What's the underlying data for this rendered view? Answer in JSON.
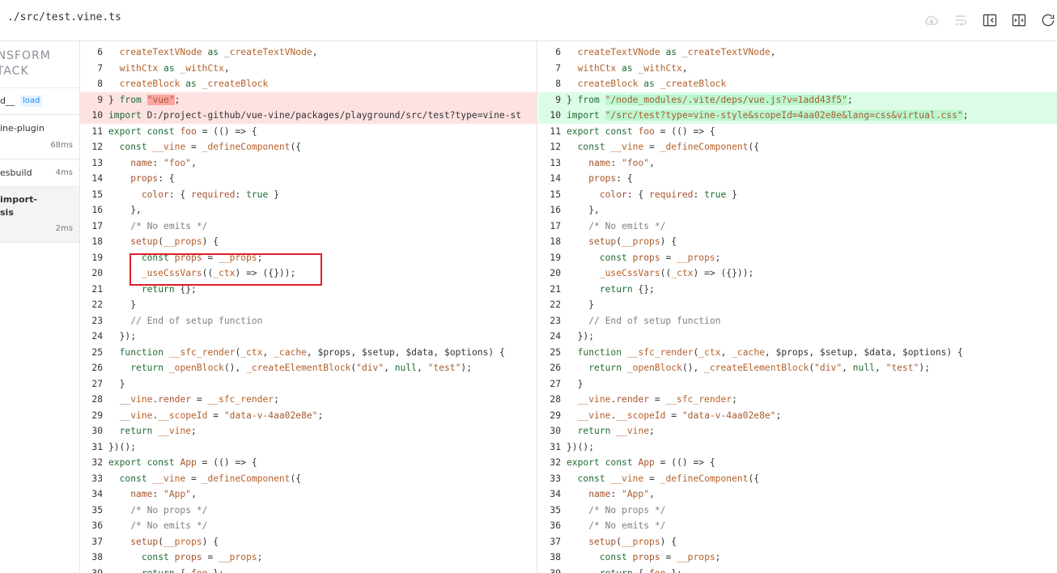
{
  "header": {
    "file_path": "./src/test.vine.ts",
    "icons": [
      "cloud-icon",
      "wrap-lines-icon",
      "collapse-left-icon",
      "diff-split-icon",
      "refresh-icon"
    ]
  },
  "sidebar": {
    "title": "ANSFORM STACK",
    "rows": [
      {
        "name": "d__",
        "badge": "load",
        "time": ""
      },
      {
        "name": "ine-plugin",
        "time": "68ms"
      },
      {
        "name": "esbuild",
        "time": "4ms"
      },
      {
        "name": "import-\nsis",
        "time": "2ms"
      }
    ]
  },
  "colors": {
    "removed_bg": "#fee2e2",
    "added_bg": "#dcfce7",
    "highlight_box": "#e11d2a"
  },
  "left_lines": [
    {
      "n": "6",
      "t": "  createTextVNode as _createTextVNode,"
    },
    {
      "n": "7",
      "t": "  withCtx as _withCtx,"
    },
    {
      "n": "8",
      "t": "  createBlock as _createBlock"
    },
    {
      "n": "9",
      "t": "} from \"vue\";",
      "type": "del"
    },
    {
      "n": "10",
      "t": "import \"D:/project-github/vue-vine/packages/playground/src/test?type=vine-st",
      "type": "del"
    },
    {
      "n": "11",
      "t": "export const foo = (() => {"
    },
    {
      "n": "12",
      "t": "  const __vine = _defineComponent({"
    },
    {
      "n": "13",
      "t": "    name: \"foo\","
    },
    {
      "n": "14",
      "t": "    props: {"
    },
    {
      "n": "15",
      "t": "      color: { required: true }"
    },
    {
      "n": "16",
      "t": "    },"
    },
    {
      "n": "17",
      "t": "    /* No emits */"
    },
    {
      "n": "18",
      "t": "    setup(__props) {"
    },
    {
      "n": "19",
      "t": "      const props = __props;"
    },
    {
      "n": "20",
      "t": "      _useCssVars((_ctx) => ({}));"
    },
    {
      "n": "21",
      "t": "      return {};"
    },
    {
      "n": "22",
      "t": "    }"
    },
    {
      "n": "23",
      "t": "    // End of setup function"
    },
    {
      "n": "24",
      "t": "  });"
    },
    {
      "n": "25",
      "t": "  function __sfc_render(_ctx, _cache, $props, $setup, $data, $options) {"
    },
    {
      "n": "26",
      "t": "    return _openBlock(), _createElementBlock(\"div\", null, \"test\");"
    },
    {
      "n": "27",
      "t": "  }"
    },
    {
      "n": "28",
      "t": "  __vine.render = __sfc_render;"
    },
    {
      "n": "29",
      "t": "  __vine.__scopeId = \"data-v-4aa02e8e\";"
    },
    {
      "n": "30",
      "t": "  return __vine;"
    },
    {
      "n": "31",
      "t": "})();"
    },
    {
      "n": "32",
      "t": "export const App = (() => {"
    },
    {
      "n": "33",
      "t": "  const __vine = _defineComponent({"
    },
    {
      "n": "34",
      "t": "    name: \"App\","
    },
    {
      "n": "35",
      "t": "    /* No props */"
    },
    {
      "n": "36",
      "t": "    /* No emits */"
    },
    {
      "n": "37",
      "t": "    setup(__props) {"
    },
    {
      "n": "38",
      "t": "      const props = __props;"
    },
    {
      "n": "39",
      "t": "      return { foo };"
    }
  ],
  "right_lines": [
    {
      "n": "6",
      "t": "  createTextVNode as _createTextVNode,"
    },
    {
      "n": "7",
      "t": "  withCtx as _withCtx,"
    },
    {
      "n": "8",
      "t": "  createBlock as _createBlock"
    },
    {
      "n": "9",
      "t": "} from \"/node_modules/.vite/deps/vue.js?v=1add43f5\";",
      "type": "add"
    },
    {
      "n": "10",
      "t": "import \"/src/test?type=vine-style&scopeId=4aa02e8e&lang=css&virtual.css\";",
      "type": "add"
    },
    {
      "n": "11",
      "t": "export const foo = (() => {"
    },
    {
      "n": "12",
      "t": "  const __vine = _defineComponent({"
    },
    {
      "n": "13",
      "t": "    name: \"foo\","
    },
    {
      "n": "14",
      "t": "    props: {"
    },
    {
      "n": "15",
      "t": "      color: { required: true }"
    },
    {
      "n": "16",
      "t": "    },"
    },
    {
      "n": "17",
      "t": "    /* No emits */"
    },
    {
      "n": "18",
      "t": "    setup(__props) {"
    },
    {
      "n": "19",
      "t": "      const props = __props;"
    },
    {
      "n": "20",
      "t": "      _useCssVars((_ctx) => ({}));"
    },
    {
      "n": "21",
      "t": "      return {};"
    },
    {
      "n": "22",
      "t": "    }"
    },
    {
      "n": "23",
      "t": "    // End of setup function"
    },
    {
      "n": "24",
      "t": "  });"
    },
    {
      "n": "25",
      "t": "  function __sfc_render(_ctx, _cache, $props, $setup, $data, $options) {"
    },
    {
      "n": "26",
      "t": "    return _openBlock(), _createElementBlock(\"div\", null, \"test\");"
    },
    {
      "n": "27",
      "t": "  }"
    },
    {
      "n": "28",
      "t": "  __vine.render = __sfc_render;"
    },
    {
      "n": "29",
      "t": "  __vine.__scopeId = \"data-v-4aa02e8e\";"
    },
    {
      "n": "30",
      "t": "  return __vine;"
    },
    {
      "n": "31",
      "t": "})();"
    },
    {
      "n": "32",
      "t": "export const App = (() => {"
    },
    {
      "n": "33",
      "t": "  const __vine = _defineComponent({"
    },
    {
      "n": "34",
      "t": "    name: \"App\","
    },
    {
      "n": "35",
      "t": "    /* No props */"
    },
    {
      "n": "36",
      "t": "    /* No emits */"
    },
    {
      "n": "37",
      "t": "    setup(__props) {"
    },
    {
      "n": "38",
      "t": "      const props = __props;"
    },
    {
      "n": "39",
      "t": "      return { foo };"
    }
  ]
}
